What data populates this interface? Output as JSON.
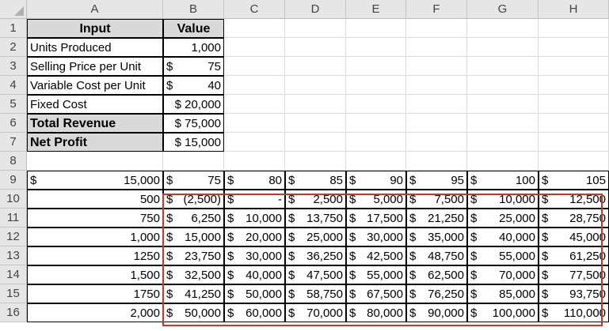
{
  "columns": [
    "A",
    "B",
    "C",
    "D",
    "E",
    "F",
    "G",
    "H"
  ],
  "rows": [
    "1",
    "2",
    "3",
    "4",
    "5",
    "6",
    "7",
    "8",
    "9",
    "10",
    "11",
    "12",
    "13",
    "14",
    "15",
    "16"
  ],
  "input_table": {
    "header_input": "Input",
    "header_value": "Value",
    "units_label": "Units Produced",
    "units_value": "1,000",
    "price_label": "Selling Price per Unit",
    "price_sym": "$",
    "price_value": "75",
    "varcost_label": "Variable Cost per Unit",
    "varcost_sym": "$",
    "varcost_value": "40",
    "fixed_label": "Fixed Cost",
    "fixed_value": "$ 20,000",
    "revenue_label": "Total Revenue",
    "revenue_value": "$ 75,000",
    "profit_label": "Net Profit",
    "profit_value": "$ 15,000"
  },
  "data_table": {
    "corner_sym": "$",
    "corner_value": "15,000",
    "prices": [
      {
        "sym": "$",
        "val": "75"
      },
      {
        "sym": "$",
        "val": "80"
      },
      {
        "sym": "$",
        "val": "85"
      },
      {
        "sym": "$",
        "val": "90"
      },
      {
        "sym": "$",
        "val": "95"
      },
      {
        "sym": "$",
        "val": "100"
      },
      {
        "sym": "$",
        "val": "105"
      }
    ],
    "units": [
      "500",
      "750",
      "1,000",
      "1250",
      "1,500",
      "1750",
      "2,000"
    ],
    "values": [
      [
        {
          "sym": "$",
          "val": "(2,500)"
        },
        {
          "sym": "$",
          "val": "-"
        },
        {
          "sym": "$",
          "val": "2,500"
        },
        {
          "sym": "$",
          "val": "5,000"
        },
        {
          "sym": "$",
          "val": "7,500"
        },
        {
          "sym": "$",
          "val": "10,000"
        },
        {
          "sym": "$",
          "val": "12,500"
        }
      ],
      [
        {
          "sym": "$",
          "val": "6,250"
        },
        {
          "sym": "$",
          "val": "10,000"
        },
        {
          "sym": "$",
          "val": "13,750"
        },
        {
          "sym": "$",
          "val": "17,500"
        },
        {
          "sym": "$",
          "val": "21,250"
        },
        {
          "sym": "$",
          "val": "25,000"
        },
        {
          "sym": "$",
          "val": "28,750"
        }
      ],
      [
        {
          "sym": "$",
          "val": "15,000"
        },
        {
          "sym": "$",
          "val": "20,000"
        },
        {
          "sym": "$",
          "val": "25,000"
        },
        {
          "sym": "$",
          "val": "30,000"
        },
        {
          "sym": "$",
          "val": "35,000"
        },
        {
          "sym": "$",
          "val": "40,000"
        },
        {
          "sym": "$",
          "val": "45,000"
        }
      ],
      [
        {
          "sym": "$",
          "val": "23,750"
        },
        {
          "sym": "$",
          "val": "30,000"
        },
        {
          "sym": "$",
          "val": "36,250"
        },
        {
          "sym": "$",
          "val": "42,500"
        },
        {
          "sym": "$",
          "val": "48,750"
        },
        {
          "sym": "$",
          "val": "55,000"
        },
        {
          "sym": "$",
          "val": "61,250"
        }
      ],
      [
        {
          "sym": "$",
          "val": "32,500"
        },
        {
          "sym": "$",
          "val": "40,000"
        },
        {
          "sym": "$",
          "val": "47,500"
        },
        {
          "sym": "$",
          "val": "55,000"
        },
        {
          "sym": "$",
          "val": "62,500"
        },
        {
          "sym": "$",
          "val": "70,000"
        },
        {
          "sym": "$",
          "val": "77,500"
        }
      ],
      [
        {
          "sym": "$",
          "val": "41,250"
        },
        {
          "sym": "$",
          "val": "50,000"
        },
        {
          "sym": "$",
          "val": "58,750"
        },
        {
          "sym": "$",
          "val": "67,500"
        },
        {
          "sym": "$",
          "val": "76,250"
        },
        {
          "sym": "$",
          "val": "85,000"
        },
        {
          "sym": "$",
          "val": "93,750"
        }
      ],
      [
        {
          "sym": "$",
          "val": "50,000"
        },
        {
          "sym": "$",
          "val": "60,000"
        },
        {
          "sym": "$",
          "val": "70,000"
        },
        {
          "sym": "$",
          "val": "80,000"
        },
        {
          "sym": "$",
          "val": "90,000"
        },
        {
          "sym": "$",
          "val": "100,000"
        },
        {
          "sym": "$",
          "val": "110,000"
        }
      ]
    ]
  },
  "colors": {
    "header_bg": "#e6e6e6",
    "label_bg": "#d9d9d9",
    "highlight_border": "#c0392b"
  }
}
